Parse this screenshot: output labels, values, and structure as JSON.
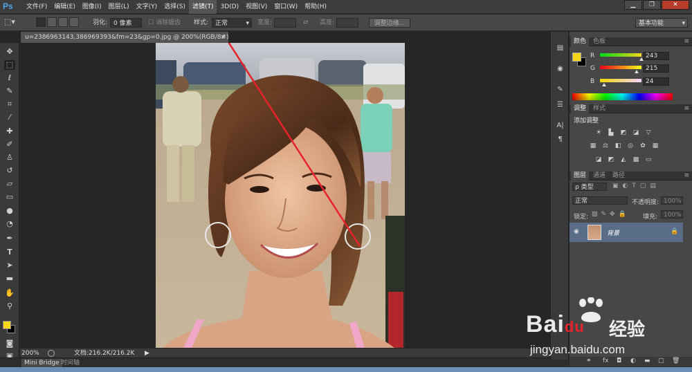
{
  "app": {
    "logo": "Ps"
  },
  "menubar": {
    "items": [
      "文件(F)",
      "编辑(E)",
      "图像(I)",
      "图层(L)",
      "文字(Y)",
      "选择(S)",
      "滤镜(T)",
      "3D(D)",
      "视图(V)",
      "窗口(W)",
      "帮助(H)"
    ],
    "active_index": 6
  },
  "window_controls": {
    "minimize": "▁",
    "restore": "❐",
    "close": "✕"
  },
  "options_bar": {
    "feather_label": "羽化:",
    "feather_value": "0 像素",
    "antialias_label": "消除锯齿",
    "style_label": "样式:",
    "style_value": "正常",
    "width_label": "宽度:",
    "swap_icon": "⇄",
    "height_label": "高度:",
    "refine_edge_button": "调整边缘...",
    "workspace_value": "基本功能"
  },
  "document": {
    "tab_title": "u=2386963143,386969393&fm=23&gp=0.jpg @ 200%(RGB/8#)",
    "close_label": "×"
  },
  "statusbar": {
    "zoom": "200%",
    "doc_info": "文档:216.2K/216.2K",
    "arrow": "▶"
  },
  "bottom_tabs": [
    "Mini Bridge",
    "时间轴"
  ],
  "color_panel": {
    "tabs": [
      "颜色",
      "色板"
    ],
    "foreground_color": "#f3d718",
    "background_color": "#000000",
    "r_label": "R",
    "g_label": "G",
    "b_label": "B",
    "r_value": "243",
    "g_value": "215",
    "b_value": "24"
  },
  "adjustments_panel": {
    "tabs": [
      "调整",
      "样式"
    ],
    "title": "添加调整"
  },
  "layers_panel": {
    "tabs": [
      "图层",
      "通道",
      "路径"
    ],
    "kind_filter": "ρ 类型",
    "blend_mode": "正常",
    "opacity_label": "不透明度:",
    "opacity_value": "100%",
    "lock_label": "锁定:",
    "fill_label": "填充:",
    "fill_value": "100%",
    "layer_name": "背景"
  },
  "watermark": {
    "brand": "Bai",
    "brand_suffix": "du",
    "cn": "经验",
    "url": "jingyan.baidu.com"
  }
}
